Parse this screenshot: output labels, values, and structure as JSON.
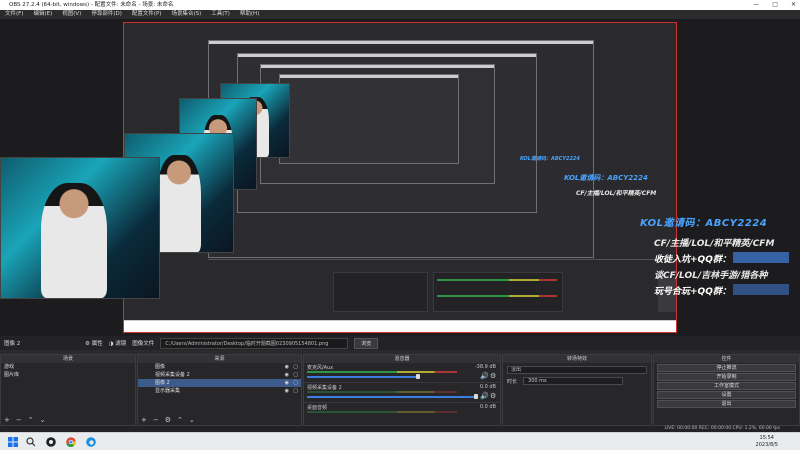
{
  "window": {
    "title": "OBS 27.2.4 (64-bit, windows) - 配置文件: 未命名 - 场景: 未命名",
    "controls": [
      "—",
      "□",
      "✕"
    ]
  },
  "menu": [
    "文件(F)",
    "编辑(E)",
    "视图(V)",
    "停靠部件(D)",
    "配置文件(P)",
    "场景集合(S)",
    "工具(T)",
    "帮助(H)"
  ],
  "overlay": {
    "line1": "KOL邀请码：ABCY2224",
    "line2": "CF/主播/LOL/和平精英/CFM",
    "line3": "收徒入坑+QQ群：",
    "line4": "谈CF/LOL/吉林手游/猎各种",
    "line5": "玩号合玩+QQ群：",
    "accent": "#4aa3ff",
    "qq_box": "#3d74c7"
  },
  "toolbar": {
    "source_name": "图像 2",
    "properties_label": "属性",
    "filters_label": "滤镜",
    "image_file_label": "图像文件",
    "path": "C:/Users/Administrator/Desktop/临时开题截图0230905154801.png",
    "browse_label": "浏览"
  },
  "scenes": {
    "header": "场景",
    "items": [
      "游戏",
      "图片库"
    ],
    "selected": 0
  },
  "sources": {
    "header": "来源",
    "items": [
      "图像",
      "视频采集设备 2",
      "图像 2",
      "显示器采集"
    ],
    "selected": 2
  },
  "mixer": {
    "header": "混音器",
    "channels": [
      {
        "name": "麦克风/Aux",
        "db": "-38.9 dB"
      },
      {
        "name": "视频采集设备 2",
        "db": "0.0 dB"
      },
      {
        "name": "桌面音频",
        "db": "0.0 dB"
      }
    ]
  },
  "transitions": {
    "header": "转场特效",
    "type": "淡出",
    "duration_label": "时长",
    "duration_value": "300 ms"
  },
  "controls": {
    "header": "控件",
    "buttons": [
      "停止推流",
      "开始录制",
      "工作室模式",
      "设置",
      "退出"
    ]
  },
  "status": {
    "text": "LIVE: 00:00:00   REC: 00:00:00   CPU: 1.2%, 60.00 fps"
  },
  "taskbar": {
    "time": "15:54",
    "date": "2023/8/5"
  },
  "icons": [
    "windows-icon",
    "search-icon",
    "obs-icon",
    "chrome-icon",
    "edge-icon",
    "gear-icon",
    "eye-icon",
    "lock-icon",
    "plus-icon",
    "minus-icon",
    "up-icon",
    "down-icon",
    "speaker-icon"
  ]
}
